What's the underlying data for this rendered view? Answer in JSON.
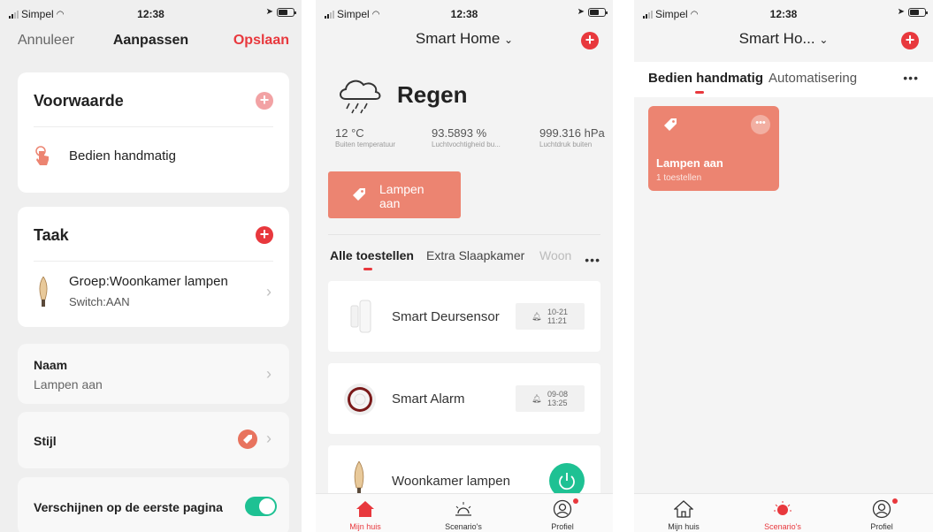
{
  "status": {
    "carrier": "Simpel",
    "time": "12:38"
  },
  "screen1": {
    "cancel": "Annuleer",
    "title": "Aanpassen",
    "save": "Opslaan",
    "condition": {
      "heading": "Voorwaarde",
      "item": "Bedien handmatig"
    },
    "task": {
      "heading": "Taak",
      "item_title": "Groep:Woonkamer lampen",
      "item_sub": "Switch:AAN"
    },
    "name": {
      "label": "Naam",
      "value": "Lampen aan"
    },
    "style": {
      "label": "Stijl",
      "color": "#e8735e"
    },
    "show_first_page": {
      "label": "Verschijnen op de eerste pagina",
      "on": true
    }
  },
  "screen2": {
    "home_title": "Smart Home",
    "weather": {
      "condition": "Regen",
      "stats": [
        {
          "value": "12 °C",
          "label": "Buiten temperatuur"
        },
        {
          "value": "93.5893 %",
          "label": "Luchtvochtigheid bu..."
        },
        {
          "value": "999.316 hPa",
          "label": "Luchtdruk buiten"
        }
      ]
    },
    "scene_tile": {
      "line1": "Lampen",
      "line2": "aan"
    },
    "tabs": [
      "Alle toestellen",
      "Extra Slaapkamer",
      "Woon"
    ],
    "devices": [
      {
        "name": "Smart Deursensor",
        "date": "10-21",
        "time": "11:21"
      },
      {
        "name": "Smart Alarm",
        "date": "09-08",
        "time": "13:25"
      },
      {
        "name": "Woonkamer lampen"
      }
    ]
  },
  "screen3": {
    "home_title": "Smart Ho...",
    "tabs": {
      "active": "Bedien handmatig",
      "other": "Automatisering"
    },
    "scene": {
      "name": "Lampen aan",
      "count": "1 toestellen"
    }
  },
  "tabbar": {
    "home": "Mijn huis",
    "scenes": "Scenario's",
    "profile": "Profiel"
  },
  "colors": {
    "accent": "#e8383d",
    "scene": "#ec8471",
    "toggle": "#1ec193"
  }
}
